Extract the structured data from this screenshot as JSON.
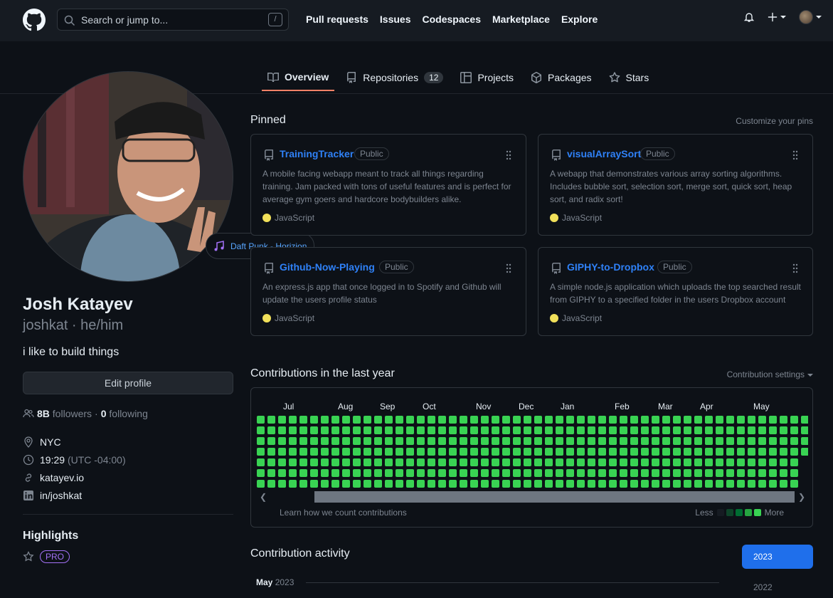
{
  "header": {
    "search_placeholder": "Search or jump to...",
    "search_shortcut": "/",
    "nav": [
      "Pull requests",
      "Issues",
      "Codespaces",
      "Marketplace",
      "Explore"
    ]
  },
  "tabs": [
    {
      "label": "Overview",
      "icon": "book-icon",
      "active": true
    },
    {
      "label": "Repositories",
      "icon": "repo-icon",
      "count": "12"
    },
    {
      "label": "Projects",
      "icon": "table-icon"
    },
    {
      "label": "Packages",
      "icon": "package-icon"
    },
    {
      "label": "Stars",
      "icon": "star-icon"
    }
  ],
  "profile": {
    "status": "Daft Punk - Horizion",
    "name": "Josh Katayev",
    "handle": "joshkat · he/him",
    "bio": "i like to build things",
    "edit_label": "Edit profile",
    "followers_count": "8B",
    "followers_label": "followers",
    "sep": "·",
    "following_count": "0",
    "following_label": "following",
    "location": "NYC",
    "time": "19:29",
    "tz": "(UTC -04:00)",
    "website": "katayev.io",
    "linkedin": "in/joshkat",
    "highlights_title": "Highlights",
    "pro_label": "PRO"
  },
  "pinned": {
    "title": "Pinned",
    "customize": "Customize your pins",
    "cards": [
      {
        "name": "TrainingTracker",
        "visibility": "Public",
        "desc": "A mobile facing webapp meant to track all things regarding training. Jam packed with tons of useful features and is perfect for average gym goers and hardcore bodybuilders alike.",
        "lang": "JavaScript"
      },
      {
        "name": "visualArraySort",
        "visibility": "Public",
        "desc": "A webapp that demonstrates various array sorting algorithms. Includes bubble sort, selection sort, merge sort, quick sort, heap sort, and radix sort!",
        "lang": "JavaScript"
      },
      {
        "name": "Github-Now-Playing",
        "visibility": "Public",
        "desc": "An express.js app that once logged in to Spotify and Github will update the users profile status",
        "lang": "JavaScript"
      },
      {
        "name": "GIPHY-to-Dropbox",
        "visibility": "Public",
        "desc": "A simple node.js application which uploads the top searched result from GIPHY to a specified folder in the users Dropbox account",
        "lang": "JavaScript"
      }
    ]
  },
  "contributions": {
    "title": "Contributions in the last year",
    "settings": "Contribution settings",
    "months": [
      "Jul",
      "Aug",
      "Sep",
      "Oct",
      "Nov",
      "Dec",
      "Jan",
      "Feb",
      "Mar",
      "Apr",
      "May"
    ],
    "learn": "Learn how we count contributions",
    "less": "Less",
    "more": "More",
    "cell_color": "#39d353",
    "legend_colors": [
      "#161b22",
      "#0e4429",
      "#006d32",
      "#26a641",
      "#39d353"
    ]
  },
  "activity": {
    "title": "Contribution activity",
    "year_selected": "2023",
    "year_other": "2022",
    "month": "May",
    "month_year": "2023"
  }
}
